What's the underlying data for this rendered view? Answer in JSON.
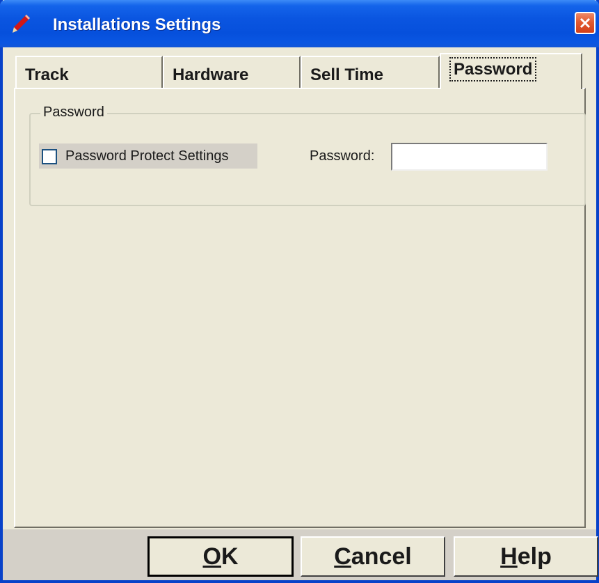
{
  "window": {
    "title": "Installations Settings",
    "title_icon": "pencil-icon",
    "close_icon": "close-icon"
  },
  "tabs": [
    {
      "label": "Track",
      "active": false
    },
    {
      "label": "Hardware",
      "active": false
    },
    {
      "label": "Sell Time",
      "active": false
    },
    {
      "label": "Password",
      "active": true
    }
  ],
  "password_group": {
    "legend": "Password",
    "checkbox_label": "Password Protect Settings",
    "checkbox_checked": false,
    "password_label": "Password:",
    "password_value": ""
  },
  "buttons": {
    "ok": {
      "accel": "O",
      "rest": "K"
    },
    "cancel": {
      "accel": "C",
      "rest": "ancel"
    },
    "help": {
      "accel": "H",
      "rest": "elp"
    }
  }
}
